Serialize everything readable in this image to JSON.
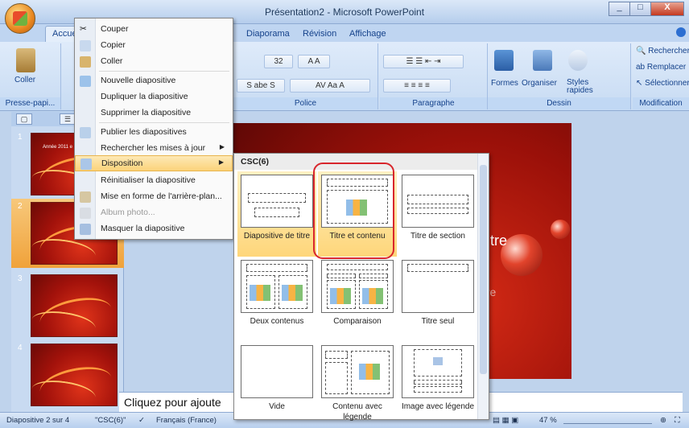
{
  "window": {
    "title": "Présentation2 - Microsoft PowerPoint",
    "min": "_",
    "max": "□",
    "close": "X"
  },
  "tabs": [
    "Accueil",
    "Diaporama",
    "Révision",
    "Affichage"
  ],
  "ribbon": {
    "clipboard_label": "Presse-papi...",
    "paste_label": "Coller",
    "font_label": "Police",
    "font_size": "32",
    "paragraph_label": "Paragraphe",
    "drawing_label": "Dessin",
    "formes": "Formes",
    "organiser": "Organiser",
    "styles": "Styles rapides",
    "edit_label": "Modification",
    "rechercher": "Rechercher",
    "remplacer": "Remplacer",
    "selectionner": "Sélectionner"
  },
  "context_menu": {
    "items": [
      {
        "label": "Couper",
        "icon": "scissors-icon"
      },
      {
        "label": "Copier",
        "icon": "copy-icon"
      },
      {
        "label": "Coller",
        "icon": "paste-icon"
      },
      {
        "label": "Nouvelle diapositive",
        "icon": "new-slide-icon"
      },
      {
        "label": "Dupliquer la diapositive",
        "icon": ""
      },
      {
        "label": "Supprimer la diapositive",
        "icon": ""
      },
      {
        "label": "Publier les diapositives",
        "icon": "publish-icon"
      },
      {
        "label": "Rechercher les mises à jour",
        "icon": ""
      },
      {
        "label": "Disposition",
        "icon": "layout-icon"
      },
      {
        "label": "Réinitialiser la diapositive",
        "icon": ""
      },
      {
        "label": "Mise en forme de l'arrière-plan...",
        "icon": "background-icon"
      },
      {
        "label": "Album photo...",
        "icon": "album-icon"
      },
      {
        "label": "Masquer la diapositive",
        "icon": "hide-slide-icon"
      }
    ]
  },
  "layout_gallery": {
    "header": "CSC(6)",
    "layouts": [
      "Diapositive de titre",
      "Titre et contenu",
      "Titre de section",
      "Deux contenus",
      "Comparaison",
      "Titre seul",
      "Vide",
      "Contenu avec légende",
      "Image avec légende"
    ]
  },
  "slides": {
    "numbers": [
      "1",
      "2",
      "3",
      "4"
    ],
    "thumb1_title": "Année 2011 e"
  },
  "slide": {
    "title_fragment": "titre",
    "subtitle_fragment": "tre"
  },
  "notes": {
    "placeholder": "Cliquez pour ajoute"
  },
  "status": {
    "slide_info": "Diapositive 2 sur 4",
    "theme": "\"CSC(6)\"",
    "language": "Français (France)",
    "zoom": "47 %"
  }
}
